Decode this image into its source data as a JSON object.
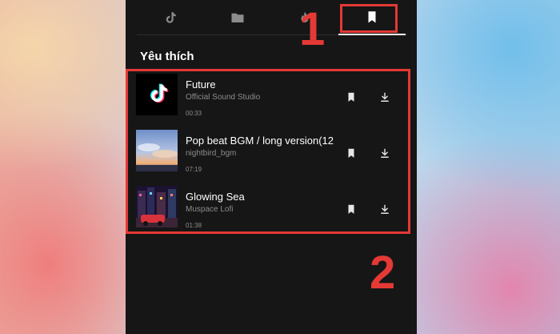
{
  "tabs": [
    {
      "icon": "tiktok-note-icon",
      "active": false
    },
    {
      "icon": "folder-icon",
      "active": false
    },
    {
      "icon": "fire-icon",
      "active": false
    },
    {
      "icon": "bookmark-icon",
      "active": true
    }
  ],
  "section_title": "Yêu thích",
  "tracks": [
    {
      "title": "Future",
      "artist": "Official Sound Studio",
      "duration": "00:33",
      "thumb": "tiktok-logo"
    },
    {
      "title": "Pop beat BGM / long version(12",
      "artist": "nightbird_bgm",
      "duration": "07:19",
      "thumb": "sky-photo"
    },
    {
      "title": "Glowing Sea",
      "artist": "Muspace Lofi",
      "duration": "01:38",
      "thumb": "city-night-photo"
    }
  ],
  "annotations": {
    "step1": "1",
    "step2": "2",
    "color": "#e53935"
  },
  "colors": {
    "panel_bg": "#161616",
    "text_primary": "#ffffff",
    "text_secondary": "#8c8c8c"
  }
}
